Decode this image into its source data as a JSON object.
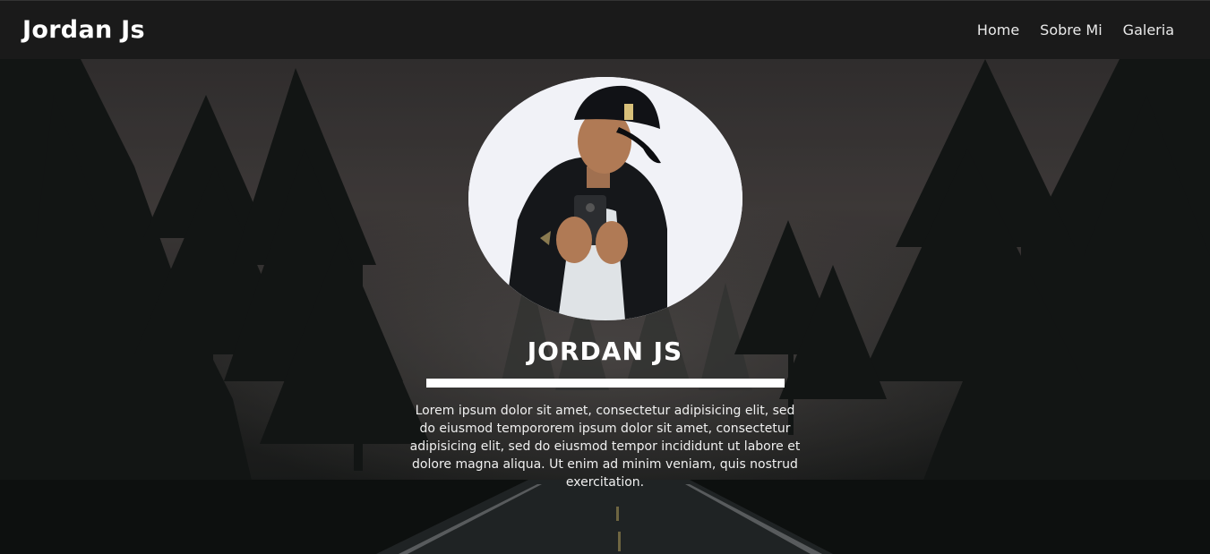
{
  "navbar": {
    "brand": "Jordan Js",
    "links": [
      {
        "label": "Home"
      },
      {
        "label": "Sobre Mi"
      },
      {
        "label": "Galeria"
      }
    ]
  },
  "profile": {
    "name": "JORDAN JS",
    "bio": "Lorem ipsum dolor sit amet, consectetur adipisicing elit, sed do eiusmod tempororem ipsum dolor sit amet, consectetur adipisicing elit, sed do eiusmod tempor incididunt ut labore et dolore magna aliqua. Ut enim ad minim veniam, quis nostrud exercitation."
  },
  "colors": {
    "navbar_bg": "#1a1a1a",
    "text": "#ffffff",
    "divider": "#ffffff"
  }
}
